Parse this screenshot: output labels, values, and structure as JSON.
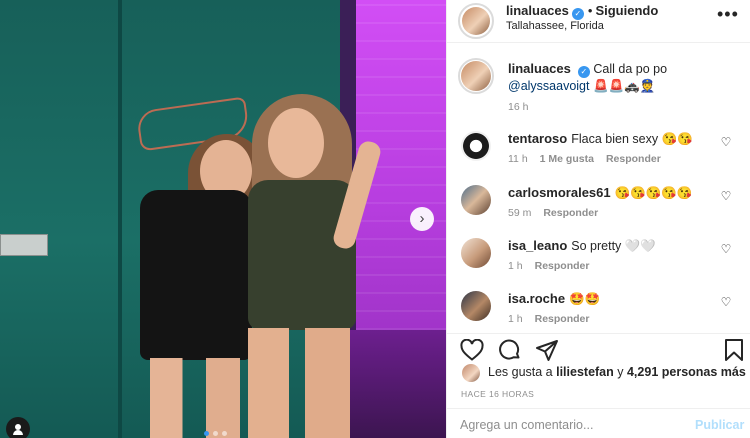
{
  "post": {
    "carousel": {
      "slides": 3,
      "current": 1
    }
  },
  "header": {
    "username": "linaluaces",
    "separator": "•",
    "follow_status": "Siguiendo",
    "location": "Tallahassee, Florida",
    "more_glyph": "•••"
  },
  "caption": {
    "username": "linaluaces",
    "text": "Call da po po",
    "mention": "@alyssaavoigt",
    "emojis": "🚨🚨🚓👮",
    "time": "16 h"
  },
  "comments": [
    {
      "username": "tentaroso",
      "text": "Flaca bien sexy 😘😘",
      "time": "11 h",
      "likes": "1 Me gusta",
      "reply": "Responder",
      "avatar_icon": "logo-avatar"
    },
    {
      "username": "carlosmorales61",
      "text": "😘😘😘😘😘",
      "time": "59 m",
      "reply": "Responder",
      "avatar_icon": "user-avatar"
    },
    {
      "username": "isa_leano",
      "text": "So pretty 🤍🤍",
      "time": "1 h",
      "reply": "Responder",
      "avatar_icon": "user-avatar"
    },
    {
      "username": "isa.roche",
      "text": "🤩🤩",
      "time": "1 h",
      "reply": "Responder",
      "avatar_icon": "user-avatar"
    }
  ],
  "likes": {
    "prefix": "Les gusta a ",
    "user": "liliestefan",
    "middle": " y ",
    "count": "4,291 personas más"
  },
  "time_ago": "HACE 16 HORAS",
  "comment_input": {
    "placeholder": "Agrega un comentario...",
    "value": ""
  },
  "post_button": "Publicar",
  "icons": [
    "heart-icon",
    "comment-icon",
    "share-icon",
    "bookmark-icon",
    "chevron-right-icon",
    "user-tag-icon",
    "verified-icon",
    "more-options-icon"
  ],
  "colors": {
    "link": "#00376b",
    "verified": "#3897f0",
    "muted": "#8e8e8e",
    "post_disabled": "#b2dffc"
  }
}
